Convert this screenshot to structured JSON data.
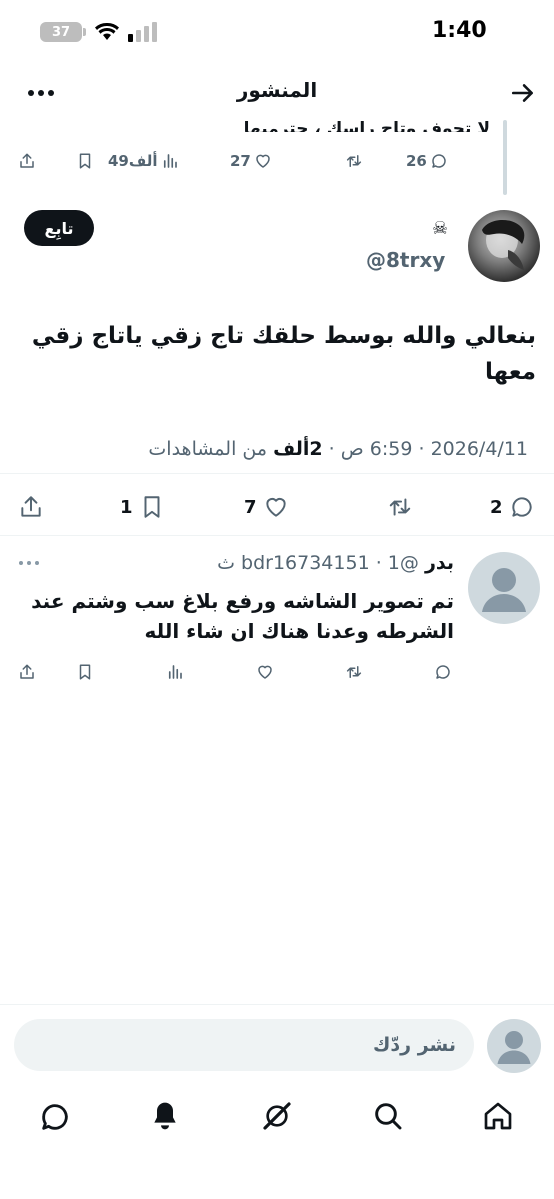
{
  "status_bar": {
    "time": "1:40",
    "battery": "37"
  },
  "header": {
    "title": "المنشور"
  },
  "previous_post": {
    "cut_text": "لا تحوف وتاج راسك ، حترميها",
    "replies": "26",
    "reposts": "",
    "likes": "27",
    "views": "49ألف"
  },
  "post": {
    "author_name": "☠",
    "author_handle": "@8trxy",
    "follow_label": "تابِع",
    "text": "بنعالي والله بوسط حلقك تاج زقي ياتاج زقي معها",
    "date": "2026/4/11",
    "time": "6:59 ص",
    "views_count": "2ألف",
    "views_label": "من المشاهدات",
    "replies": "2",
    "likes": "7",
    "bookmarks": "1"
  },
  "reply": {
    "name": "بدر",
    "handle": "@bdr16734151",
    "age": "1 ث",
    "text": "تم تصوير الشاشه ورفع بلاغ  سب وشتم عند الشرطه وعدنا هناك ان شاء الله"
  },
  "composer": {
    "placeholder": "نشر ردّك"
  },
  "icons": {
    "back": "arrow-right-icon",
    "more": "more-dots-icon",
    "reply": "comment-icon",
    "repost": "repost-icon",
    "like": "heart-icon",
    "views": "views-icon",
    "bookmark": "bookmark-icon",
    "share": "share-icon",
    "nav": [
      "home-icon",
      "search-icon",
      "grok-icon",
      "notifications-icon",
      "messages-icon"
    ]
  },
  "colors": {
    "text": "#0f1419",
    "secondary": "#536471",
    "divider": "#eff3f4",
    "follow_bg": "#0f1419"
  }
}
